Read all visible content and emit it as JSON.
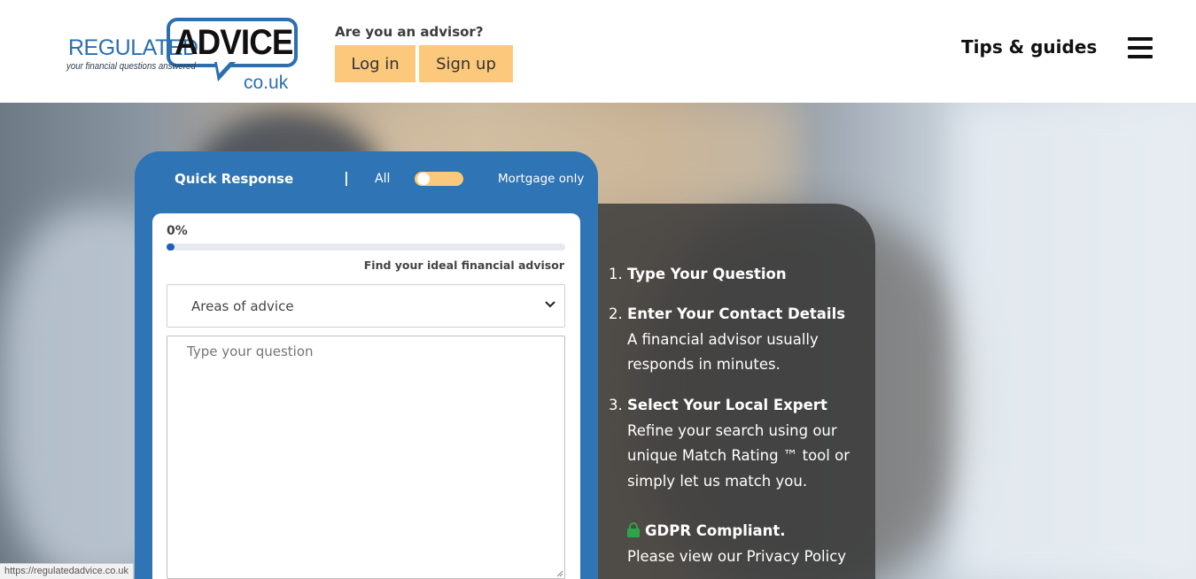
{
  "header": {
    "logo": {
      "word1": "REGULATED",
      "word2": "ADVICE",
      "tagline": "your financial questions answered",
      "domain": "co.uk"
    },
    "advisor_question": "Are you an advisor?",
    "login_label": "Log in",
    "signup_label": "Sign up",
    "tips_label": "Tips & guides",
    "menu_icon": "hamburger-icon"
  },
  "form": {
    "title": "Quick Response",
    "separator": "|",
    "toggle_left": "All",
    "toggle_right": "Mortgage only",
    "toggle_state": "all",
    "progress_text": "0%",
    "progress_value": 0.01,
    "find_label": "Find your ideal financial advisor",
    "areas_select": {
      "selected": "Areas of advice"
    },
    "question_placeholder": "Type your question"
  },
  "steps": [
    {
      "num": "1.",
      "title": "Type Your Question",
      "desc": ""
    },
    {
      "num": "2.",
      "title": "Enter Your Contact Details",
      "desc": "A financial advisor usually responds in minutes."
    },
    {
      "num": "3.",
      "title": "Select Your Local Expert",
      "desc": "Refine your search using our unique Match Rating ™ tool or simply let us match you."
    }
  ],
  "gdpr": {
    "title": "GDPR Compliant.",
    "text": "Please view our Privacy Policy",
    "icon": "lock-icon"
  },
  "status_url": "https://regulatedadvice.co.uk",
  "colors": {
    "brand_blue": "#2f74b4",
    "button_yellow": "#fcc87b",
    "lock_green": "#2fa34a"
  }
}
